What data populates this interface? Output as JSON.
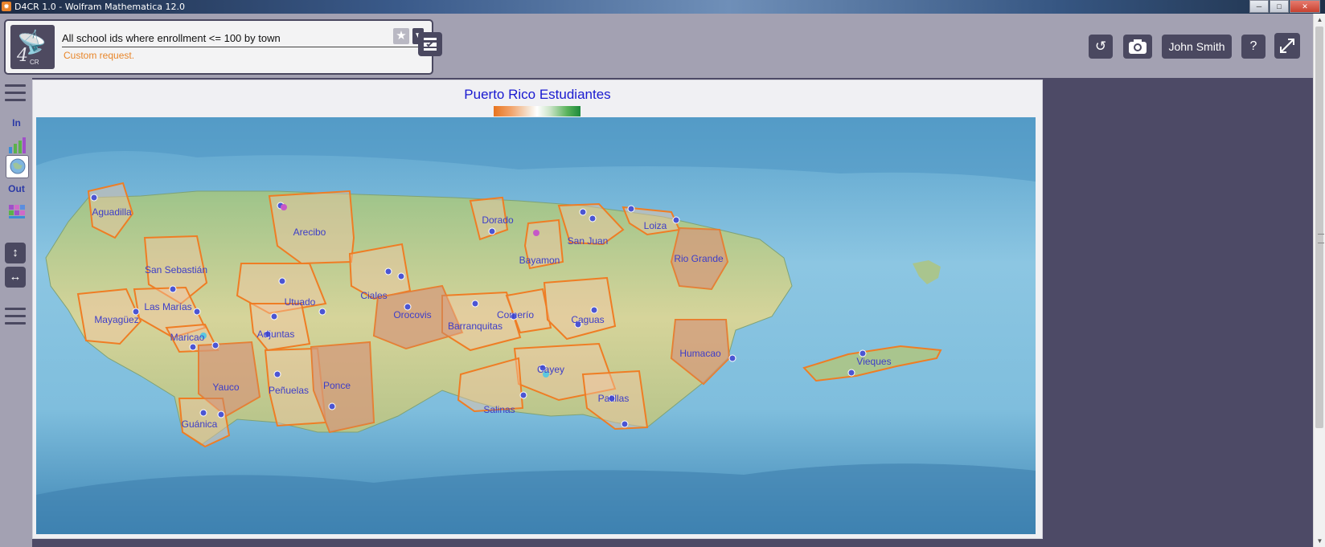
{
  "window": {
    "title": "D4CR 1.0 - Wolfram Mathematica 12.0"
  },
  "logo": {
    "text": "4",
    "sub": "CR"
  },
  "query": {
    "value": "All school ids where enrollment <= 100 by town",
    "note": "Custom request."
  },
  "toolbar": {
    "user_label": "John Smith",
    "help_label": "?"
  },
  "sidebar": {
    "in_label": "In",
    "out_label": "Out"
  },
  "map": {
    "title": "Puerto Rico Estudiantes",
    "colors": {
      "sea": "#6eb1d4",
      "deep_sea": "#3f86b5",
      "land": "#b7c28f",
      "border": "#ef7d24",
      "dot": "#4b55d3"
    },
    "towns": [
      {
        "name": "Aguadilla"
      },
      {
        "name": "Arecibo"
      },
      {
        "name": "Dorado"
      },
      {
        "name": "San Juan"
      },
      {
        "name": "Loiza"
      },
      {
        "name": "Rio Grande"
      },
      {
        "name": "Bayamon"
      },
      {
        "name": "San Sebastián"
      },
      {
        "name": "Las Marías"
      },
      {
        "name": "Mayagüez"
      },
      {
        "name": "Maricao"
      },
      {
        "name": "Utuado"
      },
      {
        "name": "Ciales"
      },
      {
        "name": "Adjuntas"
      },
      {
        "name": "Orocovis"
      },
      {
        "name": "Barranquitas"
      },
      {
        "name": "Comerío"
      },
      {
        "name": "Caguas"
      },
      {
        "name": "Humacao"
      },
      {
        "name": "Vieques"
      },
      {
        "name": "Yauco"
      },
      {
        "name": "Peñuelas"
      },
      {
        "name": "Ponce"
      },
      {
        "name": "Guánica"
      },
      {
        "name": "Cayey"
      },
      {
        "name": "Salinas"
      },
      {
        "name": "Patillas"
      }
    ]
  }
}
